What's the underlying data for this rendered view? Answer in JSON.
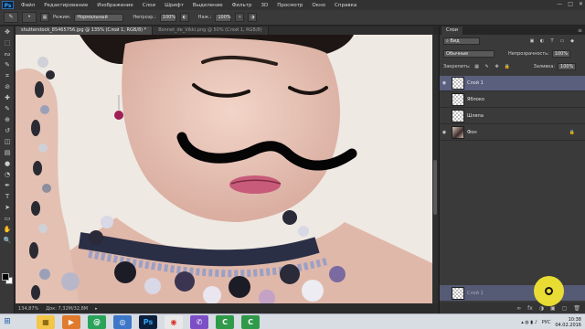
{
  "menubar": {
    "logo": "Ps",
    "items": [
      "Файл",
      "Редактирование",
      "Изображение",
      "Слои",
      "Шрифт",
      "Выделение",
      "Фильтр",
      "3D",
      "Просмотр",
      "Окно",
      "Справка"
    ],
    "window_controls": [
      "—",
      "□",
      "✕"
    ]
  },
  "options": {
    "tool_icon": "brush-icon",
    "size_value": "•",
    "mode_label": "Режим:",
    "mode_value": "Нормальный",
    "opacity_label": "Непрозр.:",
    "opacity_value": "100%",
    "flow_label": "Наж.:",
    "flow_value": "100%"
  },
  "tools": [
    "move",
    "marquee",
    "lasso",
    "quick-select",
    "crop",
    "eyedropper",
    "heal",
    "brush",
    "stamp",
    "history-brush",
    "eraser",
    "gradient",
    "blur",
    "dodge",
    "pen",
    "type",
    "path-select",
    "shape",
    "hand",
    "zoom"
  ],
  "tool_glyphs": [
    "✥",
    "⬚",
    "ᔓ",
    "✎",
    "⌗",
    "⊘",
    "✚",
    "✎",
    "⊕",
    "↺",
    "◫",
    "▤",
    "●",
    "◔",
    "✒",
    "T",
    "➤",
    "▭",
    "✋",
    "🔍"
  ],
  "doc_tabs": [
    {
      "label": "shutterstock_85465756.jpg @ 135% (Слой 1, RGB/8) *",
      "active": true
    },
    {
      "label": "Bonnet_de_Vikki.png @ 50% (Слой 1, RGB/8)",
      "active": false
    }
  ],
  "status": {
    "zoom": "134,87%",
    "doc_size": "Док: 7,32M/32,8M"
  },
  "layers_panel": {
    "tab_label": "Слои",
    "menu_icon": "≡",
    "filter_label": "Вид",
    "filter_icons": [
      "▣",
      "◐",
      "T",
      "▭",
      "◆"
    ],
    "blend_mode": "Обычные",
    "opacity_label": "Непрозрачность:",
    "opacity_value": "100%",
    "lock_label": "Закрепить:",
    "fill_label": "Заливка:",
    "fill_value": "100%",
    "layers": [
      {
        "name": "Слой 1",
        "visible": true,
        "selected": true,
        "thumb": "checker"
      },
      {
        "name": "Яблоко",
        "visible": false,
        "selected": false,
        "thumb": "checker"
      },
      {
        "name": "Шляпа",
        "visible": false,
        "selected": false,
        "thumb": "checker"
      },
      {
        "name": "Фон",
        "visible": true,
        "selected": false,
        "thumb": "photo",
        "locked": true
      }
    ],
    "bottom_layer_name": "Слой 1",
    "footer_icons": [
      "∞",
      "fx",
      "◑",
      "▣",
      "▢",
      "🗑"
    ]
  },
  "taskbar": {
    "apps": [
      {
        "name": "explorer",
        "glyph": "▦",
        "bg": "#f3c64a",
        "fg": "#6b4a00"
      },
      {
        "name": "media",
        "glyph": "▶",
        "bg": "#e07a2d",
        "fg": "#ffffff"
      },
      {
        "name": "chat",
        "glyph": "@",
        "bg": "#2aa35a",
        "fg": "#ffffff"
      },
      {
        "name": "tv",
        "glyph": "◎",
        "bg": "#3d77c8",
        "fg": "#ffffff"
      },
      {
        "name": "photoshop",
        "glyph": "Ps",
        "bg": "#0b1f3a",
        "fg": "#31a8ff"
      },
      {
        "name": "chrome",
        "glyph": "◉",
        "bg": "#e8e8e8",
        "fg": "#d93025"
      },
      {
        "name": "viber",
        "glyph": "✆",
        "bg": "#7d4fc7",
        "fg": "#ffffff"
      },
      {
        "name": "camtasia",
        "glyph": "C",
        "bg": "#2f9a4a",
        "fg": "#ffffff"
      },
      {
        "name": "camtasia-recorder",
        "glyph": "C",
        "bg": "#2f9a4a",
        "fg": "#ffffff"
      }
    ],
    "lang": "РУС",
    "time": "10:38",
    "date": "04.02.2016"
  },
  "colors": {
    "selected_layer": "#5a5f7e",
    "cursor_highlight": "#f1e432"
  }
}
